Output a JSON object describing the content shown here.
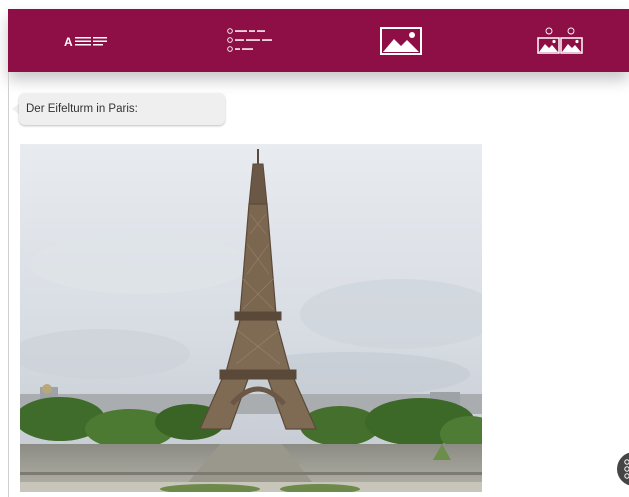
{
  "toolbar": {
    "buttons": [
      {
        "name": "text-lines-icon",
        "glyph": "A"
      },
      {
        "name": "numbered-list-icon"
      },
      {
        "name": "image-icon"
      },
      {
        "name": "image-compare-icon"
      }
    ],
    "bar_color": "#8e0f45"
  },
  "message": {
    "text": "Der Eifelturm in Paris:"
  },
  "image": {
    "subject": "Eiffel Tower photo"
  }
}
